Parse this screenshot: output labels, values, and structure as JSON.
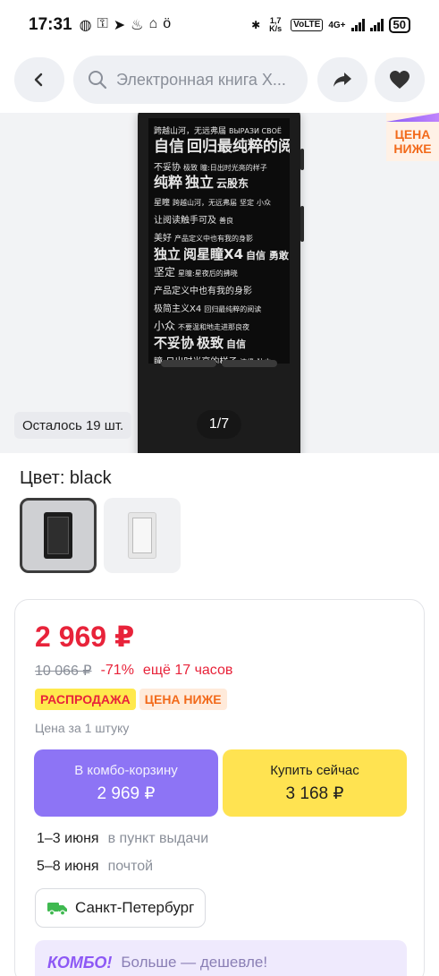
{
  "status_bar": {
    "time": "17:31",
    "net_speed": "1,7 K/s",
    "volte": "VoLTE",
    "network": "4G+",
    "battery": "50"
  },
  "nav": {
    "search_placeholder": "Электронная книга X..."
  },
  "hero": {
    "price_tag_line1": "ЦЕНА",
    "price_tag_line2": "НИЖЕ",
    "stock": "Осталось 19 шт.",
    "pager": "1/7",
    "screen_lines": [
      [
        "跨越山河，无远弗届",
        "ВЫРАЗИ СВОЁ"
      ],
      [
        "自信",
        "回归最纯粹的阅读"
      ],
      [
        "不妥协",
        "极致",
        "瞳:日出时光亮的样子"
      ],
      [
        "纯粹",
        "独立",
        "云股东"
      ],
      [
        "星瞳",
        "跨越山河，无远弗届",
        "坚定",
        "小众"
      ],
      [
        "让阅读触手可及",
        "善良"
      ],
      [
        "美好",
        "产品定义中也有我的身影"
      ],
      [
        "独立",
        "阅星瞳X4",
        "自信 勇敢"
      ],
      [
        "坚定",
        "星瞳:星夜后的拂晓"
      ],
      [
        "产品定义中也有我的身影"
      ],
      [
        "极简主义X4",
        "回归最纯粹的阅读"
      ],
      [
        "小众",
        "不要温和地走进那良夜"
      ],
      [
        "不妥协",
        "极致",
        "自信"
      ],
      [
        "瞳:日出时光亮的样子",
        "边缘",
        "独立"
      ]
    ]
  },
  "color": {
    "label": "Цвет: black",
    "options": [
      "black",
      "white"
    ]
  },
  "card": {
    "price": "2 969 ₽",
    "old_price": "10 066 ₽",
    "discount": "-71%",
    "timer": "ещё 17 часов",
    "badge_sale": "РАСПРОДАЖА",
    "badge_lower": "ЦЕНА НИЖЕ",
    "unit_note": "Цена за 1 штуку",
    "combo_btn_label": "В комбо-корзину",
    "combo_btn_price": "2 969 ₽",
    "buy_btn_label": "Купить сейчас",
    "buy_btn_price": "3 168 ₽",
    "delivery": [
      {
        "when": "1–3 июня",
        "how": "в пункт выдачи"
      },
      {
        "when": "5–8 июня",
        "how": "почтой"
      }
    ],
    "city": "Санкт-Петербург",
    "combo_logo": "КОМБО!",
    "combo_text": "Больше — дешевле!"
  },
  "colors": {
    "accent_red": "#e8233a",
    "accent_purple": "#8d74f5",
    "accent_yellow": "#ffe351",
    "accent_orange": "#f26a1b"
  }
}
